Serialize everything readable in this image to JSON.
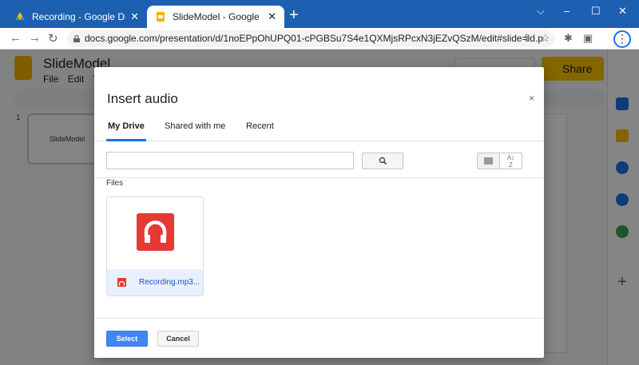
{
  "browser": {
    "tabs": [
      {
        "title": "Recording - Google Drive",
        "close": "✕"
      },
      {
        "title": "SlideModel - Google Slides",
        "close": "✕"
      }
    ],
    "new_tab": "+",
    "window_controls": {
      "minimize": "⌵",
      "restore": "–",
      "maximize": "☐",
      "close": "✕"
    },
    "url": "docs.google.com/presentation/d/1noEPpOhUPQ01-cPGBSu7S4e1QXMjsRPcxN3jEZvQSzM/edit#slide=id.p"
  },
  "app": {
    "title": "SlideModel",
    "menu": [
      "File",
      "Edit",
      "Vi"
    ],
    "share_label": "Share",
    "slide_number": "1",
    "thumb_label": "SlideModel"
  },
  "dialog": {
    "title": "Insert audio",
    "close": "×",
    "tabs": [
      {
        "label": "My Drive",
        "active": true
      },
      {
        "label": "Shared with me",
        "active": false
      },
      {
        "label": "Recent",
        "active": false
      }
    ],
    "search": {
      "value": "",
      "placeholder": ""
    },
    "sort_label": "A\nZ",
    "files_label": "Files",
    "files": [
      {
        "name": "Recording.mp3..."
      }
    ],
    "select_label": "Select",
    "cancel_label": "Cancel"
  },
  "colors": {
    "tabstrip": "#1d5fb0",
    "primary_button": "#4285f4",
    "audio_icon": "#e53935",
    "share_button": "#f9c300"
  }
}
